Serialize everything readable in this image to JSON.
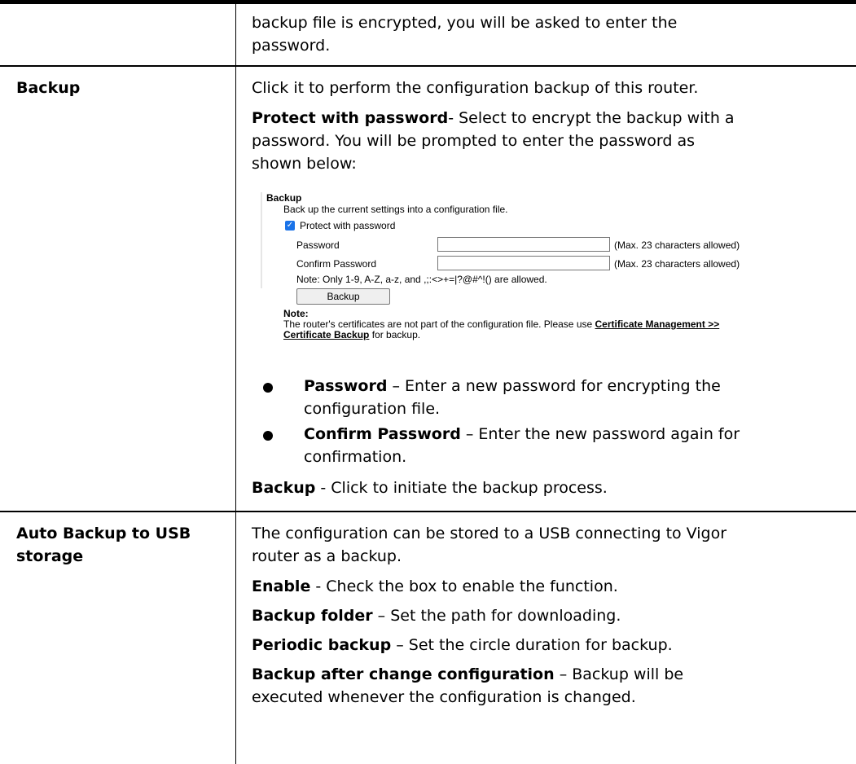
{
  "intro": {
    "line1": "backup file is encrypted, you will be asked to enter the",
    "line2": "password."
  },
  "backup_row": {
    "label": "Backup",
    "desc": "Click it to perform the configuration backup of this router.",
    "protect_title": "Protect with password",
    "protect_line1": "- Select to encrypt the backup with a",
    "protect_line2": "password. You will be prompted to enter the password as",
    "protect_line3": "shown below:",
    "screenshot": {
      "title": "Backup",
      "subtitle": "Back up the current settings into a configuration file.",
      "checkbox_label": "Protect with password",
      "checkbox_checked": true,
      "password_label": "Password",
      "password_value": "",
      "password_hint": "(Max. 23 characters allowed)",
      "confirm_label": "Confirm Password",
      "confirm_value": "",
      "confirm_hint": "(Max. 23 characters allowed)",
      "allowed_note": "Note: Only 1-9, A-Z, a-z, and ,;:<>+=|?@#^!() are allowed.",
      "backup_button": "Backup",
      "note_title": "Note:",
      "note_text": "The router's certificates are not part of the configuration file. Please use ",
      "note_link1": "Certificate Management >>",
      "note_link2": "Certificate Backup",
      "note_tail": " for backup."
    },
    "bullets": [
      {
        "term": "Password",
        "line1": " – Enter a new password for encrypting the",
        "line2": "configuration file."
      },
      {
        "term": "Confirm Password",
        "line1": " – Enter the new password again for",
        "line2": "confirmation."
      }
    ],
    "backup_action_term": "Backup",
    "backup_action_text": " - Click to initiate the backup process."
  },
  "usb_row": {
    "label_line1": "Auto Backup to USB",
    "label_line2": "storage",
    "desc_line1": "The configuration can be stored to a USB connecting to Vigor",
    "desc_line2": "router as a backup.",
    "enable_term": "Enable",
    "enable_text": " - Check the box to enable the function.",
    "folder_term": "Backup folder",
    "folder_text": " – Set the path for downloading.",
    "periodic_term": "Periodic backup",
    "periodic_text": " – Set the circle duration for backup.",
    "after_term": "Backup after change configuration",
    "after_text_line1": " – Backup will be",
    "after_text_line2": "executed whenever the configuration is changed."
  }
}
